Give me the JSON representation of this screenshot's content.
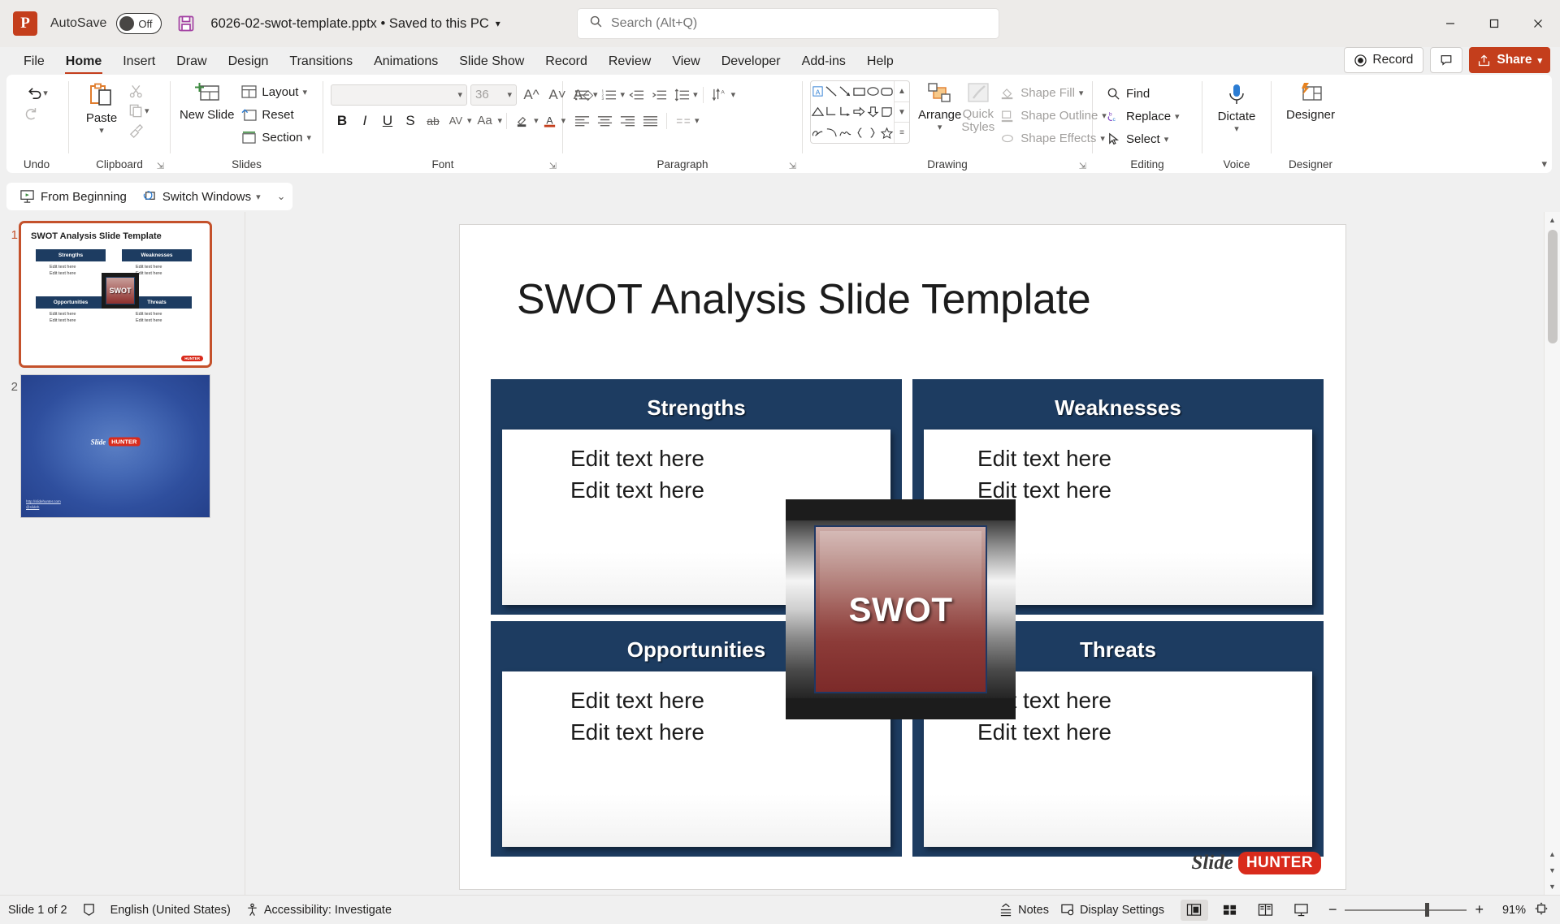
{
  "titlebar": {
    "app_logo": "powerpoint-logo",
    "autosave_label": "AutoSave",
    "autosave_state": "Off",
    "document_title": "6026-02-swot-template.pptx • Saved to this PC",
    "search_placeholder": "Search (Alt+Q)",
    "minimize": "minimize-icon",
    "maximize": "maximize-icon",
    "close": "close-icon"
  },
  "tabs": [
    {
      "label": "File",
      "active": false
    },
    {
      "label": "Home",
      "active": true
    },
    {
      "label": "Insert",
      "active": false
    },
    {
      "label": "Draw",
      "active": false
    },
    {
      "label": "Design",
      "active": false
    },
    {
      "label": "Transitions",
      "active": false
    },
    {
      "label": "Animations",
      "active": false
    },
    {
      "label": "Slide Show",
      "active": false
    },
    {
      "label": "Record",
      "active": false
    },
    {
      "label": "Review",
      "active": false
    },
    {
      "label": "View",
      "active": false
    },
    {
      "label": "Developer",
      "active": false
    },
    {
      "label": "Add-ins",
      "active": false
    },
    {
      "label": "Help",
      "active": false
    }
  ],
  "tabbar_right": {
    "record_label": "Record",
    "comment_label": "Comments",
    "share_label": "Share"
  },
  "ribbon": {
    "groups": [
      {
        "name": "Undo",
        "label": "Undo"
      },
      {
        "name": "Clipboard",
        "label": "Clipboard",
        "paste_label": "Paste",
        "cut": "Cut",
        "copy": "Copy",
        "format_painter": "Format Painter"
      },
      {
        "name": "Slides",
        "label": "Slides",
        "new_slide_label": "New Slide",
        "layout": "Layout",
        "reset": "Reset",
        "section": "Section"
      },
      {
        "name": "Font",
        "label": "Font",
        "font_name": "",
        "font_size": "36",
        "bold": "B",
        "italic": "I",
        "underline": "U",
        "shadow": "S",
        "strikethrough": "ab",
        "char_spacing": "AV",
        "change_case": "Aa"
      },
      {
        "name": "Paragraph",
        "label": "Paragraph"
      },
      {
        "name": "Drawing",
        "label": "Drawing",
        "arrange_label": "Arrange",
        "quick_styles_label": "Quick Styles",
        "shape_fill": "Shape Fill",
        "shape_outline": "Shape Outline",
        "shape_effects": "Shape Effects"
      },
      {
        "name": "Editing",
        "label": "Editing",
        "find": "Find",
        "replace": "Replace",
        "select": "Select"
      },
      {
        "name": "Voice",
        "label": "Voice",
        "dictate_label": "Dictate"
      },
      {
        "name": "Designer",
        "label": "Designer",
        "designer_label": "Designer"
      }
    ]
  },
  "quickbar": {
    "from_beginning": "From Beginning",
    "switch_windows": "Switch Windows"
  },
  "thumbnails": [
    {
      "number": "1",
      "selected": true,
      "title": "SWOT Analysis Slide Template"
    },
    {
      "number": "2",
      "selected": false,
      "title": ""
    }
  ],
  "slide": {
    "title": "SWOT Analysis Slide Template",
    "center_label": "SWOT",
    "quadrants": [
      {
        "name": "strengths",
        "header": "Strengths",
        "lines": [
          "Edit text here",
          "Edit text here"
        ]
      },
      {
        "name": "weaknesses",
        "header": "Weaknesses",
        "lines": [
          "Edit text here",
          "Edit text here"
        ]
      },
      {
        "name": "opportunities",
        "header": "Opportunities",
        "lines": [
          "Edit text here",
          "Edit text here"
        ]
      },
      {
        "name": "threats",
        "header": "Threats",
        "lines": [
          "Edit text here",
          "Edit text here"
        ]
      }
    ],
    "watermark": {
      "slide_word": "Slide",
      "hunter_word": "HUNTER"
    },
    "colors": {
      "header_navy": "#1d3c61",
      "brand_red": "#d92b1c",
      "accent_orange": "#c43e1c"
    }
  },
  "slide2": {
    "slide_word": "Slide",
    "hunter_word": "HUNTER",
    "url": "http://slidehunter.com",
    "handle": "@slideh"
  },
  "statusbar": {
    "slide_count": "Slide 1 of 2",
    "language": "English (United States)",
    "accessibility": "Accessibility: Investigate",
    "notes": "Notes",
    "display_settings": "Display Settings",
    "zoom": "91%",
    "views": [
      "normal-view",
      "slide-sorter-view",
      "reading-view",
      "slide-show-view"
    ]
  }
}
